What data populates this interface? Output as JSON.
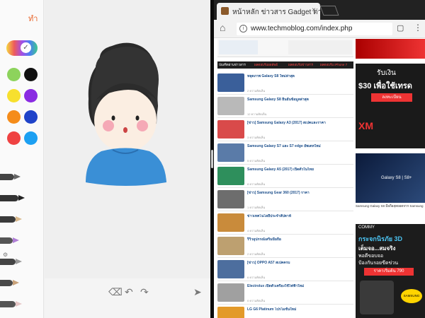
{
  "note_app": {
    "done_label": "ทำ",
    "colors": {
      "swatches": [
        "#8dd35c",
        "#111111",
        "#f7e02e",
        "#8a2be2",
        "#f58c1a",
        "#1f43c9",
        "#ef4242",
        "#1ca0f2"
      ],
      "accent": "#e8652b"
    },
    "icons": [
      "eraser-icon",
      "undo-icon",
      "redo-icon",
      "send-icon"
    ]
  },
  "browser": {
    "tab_title": "หน้าหลัก ข่าวสาร Gadget ต่างๆ",
    "url": "www.techmoblog.com/index.php",
    "nav_tabs": [
      "บัณฑิตผ่านข่าวสาร",
      "ผลตอบรับผลลัพธ์",
      "ผลตอบรับข่าวสาร",
      "ผลตอบรับ iPhone 7"
    ],
    "articles": [
      {
        "title": "หลุดภาพ Galaxy S8 ใหม่ล่าสุด",
        "meta": "2 ความคิดเห็น"
      },
      {
        "title": "Samsung Galaxy S8 ยืนยันข้อมูลล่าสุด",
        "meta": "12 ความคิดเห็น"
      },
      {
        "title": "[ข่าว] Samsung Galaxy A3 (2017) สเปคและราคา",
        "meta": "3 ความคิดเห็น"
      },
      {
        "title": "Samsung Galaxy S7 และ S7 edge อัพเดทใหม่",
        "meta": "5 ความคิดเห็น"
      },
      {
        "title": "Samsung Galaxy A5 (2017) เปิดตัวในไทย",
        "meta": "8 ความคิดเห็น"
      },
      {
        "title": "[ข่าว] Samsung Gear 360 (2017) ราคา",
        "meta": "1 ความคิดเห็น"
      },
      {
        "title": "ข่าวเทคโนโลยีประจำสัปดาห์",
        "meta": "4 ความคิดเห็น"
      },
      {
        "title": "รีวิวอุปกรณ์เสริมมือถือ",
        "meta": "2 ความคิดเห็น"
      },
      {
        "title": "[ข่าว] OPPO A57 สเปคครบ",
        "meta": "6 ความคิดเห็น"
      },
      {
        "title": "Electrolux เปิดตัวเครื่องใช้ไฟฟ้าใหม่",
        "meta": "0 ความคิดเห็น"
      },
      {
        "title": "LG G6 Platinum โปรโมชั่นใหม่",
        "meta": "1 ความคิดเห็น"
      }
    ],
    "ads": {
      "ad1_line1": "รับเงิน",
      "ad1_line2": "$30 เพื่อใช้เทรด",
      "ad1_button": "ลงทะเบียน",
      "ad2_brand": "XM",
      "ad3_model": "Galaxy S8 | S8+",
      "ad3_caption": "Samsung Galaxy S8 มือถือสุดยอดจาก Samsung",
      "ad4_brand": "COMMY",
      "ad4_line1": "กระจกนิรภัย 3D",
      "ad4_line2": "เต็มจอ...สมจริง",
      "ad4_line3": "พอดีขอบจอ",
      "ad4_line4": "ป้องกันรอยขีดข่วน",
      "ad4_price": "ราคาเริ่มต้น 790",
      "ad4_badge": "SAMSUNG"
    }
  }
}
